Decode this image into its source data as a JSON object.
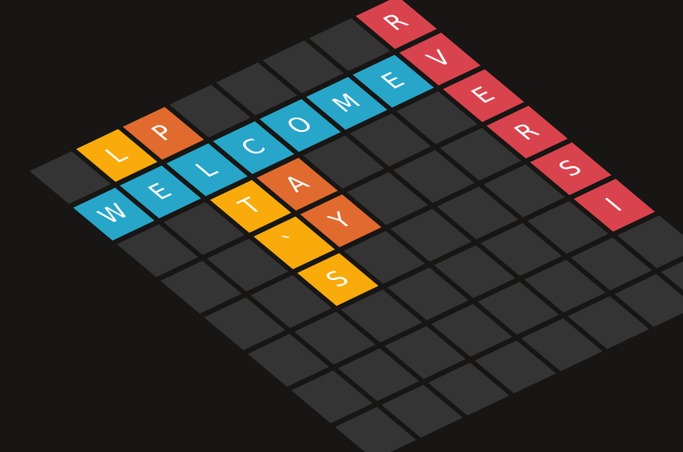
{
  "colors": {
    "background": "#171614",
    "empty_tile": "#353434",
    "blue": "#27a6c9",
    "orange": "#e16b2e",
    "yellow": "#f9ab0b",
    "red": "#d9434e"
  },
  "board": {
    "rows": 8,
    "cols": 8,
    "letters": [
      {
        "row": 0,
        "col": 7,
        "letter": "R",
        "color": "red"
      },
      {
        "row": 1,
        "col": 6,
        "letter": "E",
        "color": "blue"
      },
      {
        "row": 1,
        "col": 5,
        "letter": "M",
        "color": "blue"
      },
      {
        "row": 1,
        "col": 4,
        "letter": "O",
        "color": "blue"
      },
      {
        "row": 1,
        "col": 3,
        "letter": "C",
        "color": "blue"
      },
      {
        "row": 1,
        "col": 2,
        "letter": "L",
        "color": "blue"
      },
      {
        "row": 1,
        "col": 1,
        "letter": "E",
        "color": "blue"
      },
      {
        "row": 1,
        "col": 0,
        "letter": "W",
        "color": "blue"
      },
      {
        "row": 0,
        "col": 1,
        "letter": "L",
        "color": "yellow"
      },
      {
        "row": 0,
        "col": 2,
        "letter": "P",
        "color": "orange"
      },
      {
        "row": 2,
        "col": 2,
        "letter": "T",
        "color": "yellow"
      },
      {
        "row": 2,
        "col": 3,
        "letter": "A",
        "color": "orange"
      },
      {
        "row": 3,
        "col": 2,
        "letter": "`",
        "color": "yellow"
      },
      {
        "row": 3,
        "col": 3,
        "letter": "Y",
        "color": "orange"
      },
      {
        "row": 4,
        "col": 2,
        "letter": "S",
        "color": "yellow"
      },
      {
        "row": 1,
        "col": 7,
        "letter": "V",
        "color": "red"
      },
      {
        "row": 2,
        "col": 7,
        "letter": "E",
        "color": "red"
      },
      {
        "row": 3,
        "col": 7,
        "letter": "R",
        "color": "red"
      },
      {
        "row": 4,
        "col": 7,
        "letter": "S",
        "color": "red"
      },
      {
        "row": 5,
        "col": 7,
        "letter": "I",
        "color": "red"
      }
    ]
  }
}
